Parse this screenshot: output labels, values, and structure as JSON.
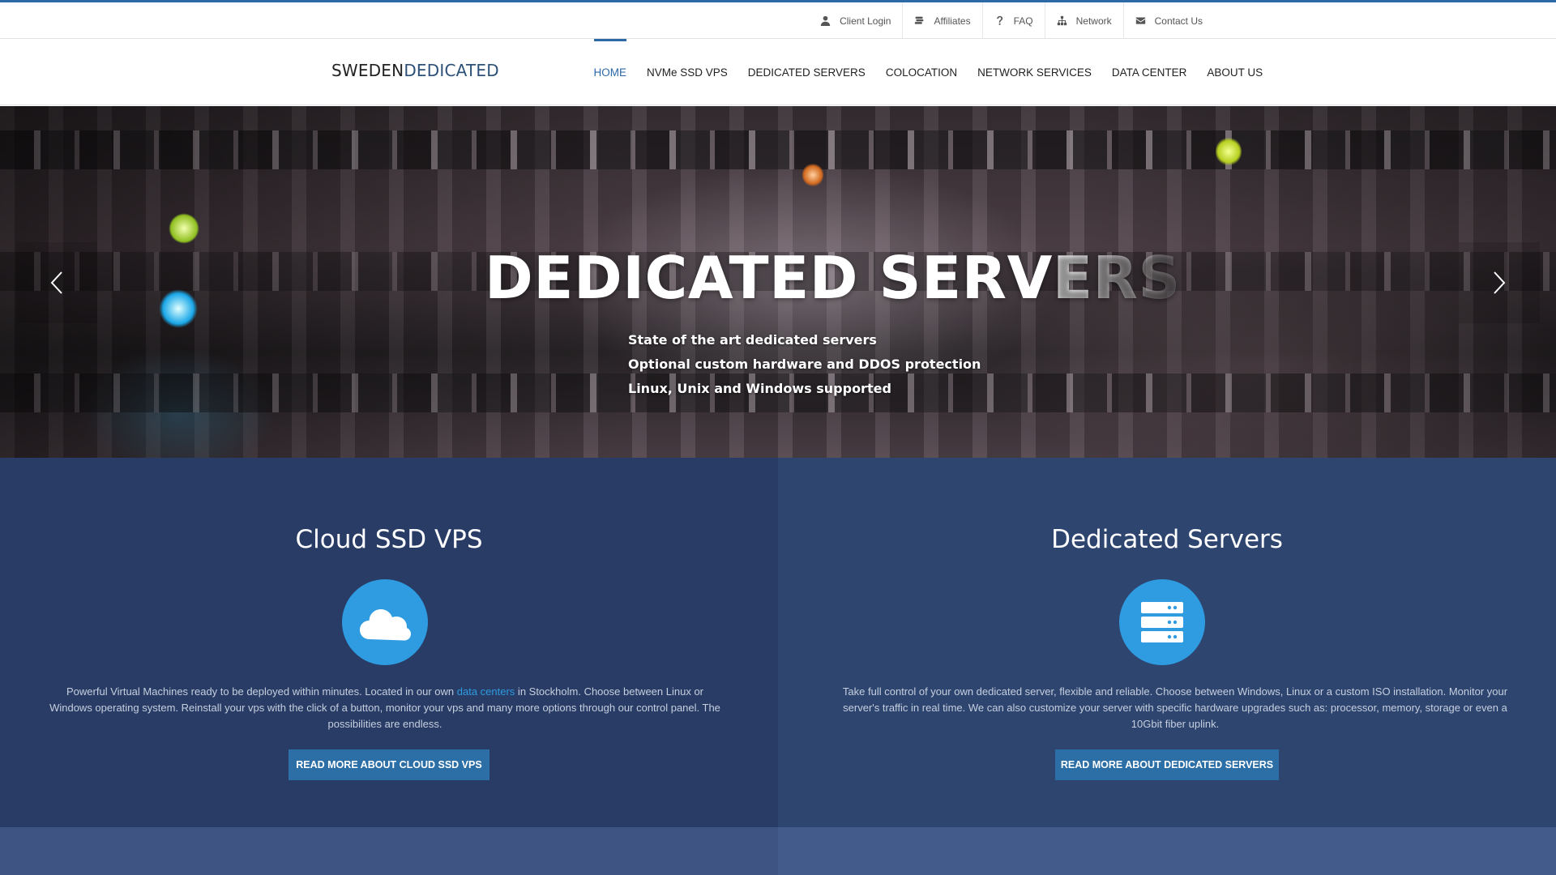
{
  "topbar": {
    "links": [
      {
        "label": "Client Login",
        "icon": "user-icon"
      },
      {
        "label": "Affiliates",
        "icon": "money-icon"
      },
      {
        "label": "FAQ",
        "icon": "question-icon"
      },
      {
        "label": "Network",
        "icon": "sitemap-icon"
      },
      {
        "label": "Contact Us",
        "icon": "envelope-icon"
      }
    ]
  },
  "header": {
    "logo_part1": "SWEDEN",
    "logo_part2": "DEDICATED",
    "nav": [
      {
        "label": "HOME",
        "active": true
      },
      {
        "label": "NVMe SSD VPS"
      },
      {
        "label": "DEDICATED SERVERS"
      },
      {
        "label": "COLOCATION"
      },
      {
        "label": "NETWORK SERVICES"
      },
      {
        "label": "DATA CENTER"
      },
      {
        "label": "ABOUT US"
      }
    ]
  },
  "hero": {
    "title_main": "DEDICATED SERV",
    "title_fade": "ERS",
    "lines": [
      "State of the art dedicated servers",
      "Optional custom hardware and DDOS protection",
      "Linux, Unix and Windows supported"
    ]
  },
  "features": {
    "vps": {
      "title": "Cloud SSD VPS",
      "icon": "cloud-icon",
      "text_before": "Powerful Virtual Machines ready to be deployed within minutes. Located in our own ",
      "link": "data centers",
      "text_after": " in Stockholm. Choose between Linux or Windows operating system. Reinstall your vps with the click of a button, monitor your vps and many more options through our control panel. The possibilities are endless.",
      "button": "READ MORE ABOUT CLOUD SSD VPS"
    },
    "dedicated": {
      "title": "Dedicated Servers",
      "icon": "server-icon",
      "text": "Take full control of your own dedicated server, flexible and reliable. Choose between Windows, Linux or a custom ISO installation. Monitor your server's traffic in real time. We can also customize your server with specific hardware upgrades such as: processor, memory, storage or even a 10Gbit fiber uplink.",
      "button": "READ MORE ABOUT DEDICATED SERVERS"
    }
  },
  "colors": {
    "accent": "#2c69a6",
    "feature_left_bg": "#283c66",
    "feature_right_bg": "#2e4570",
    "icon_circle": "#2f9be0"
  }
}
